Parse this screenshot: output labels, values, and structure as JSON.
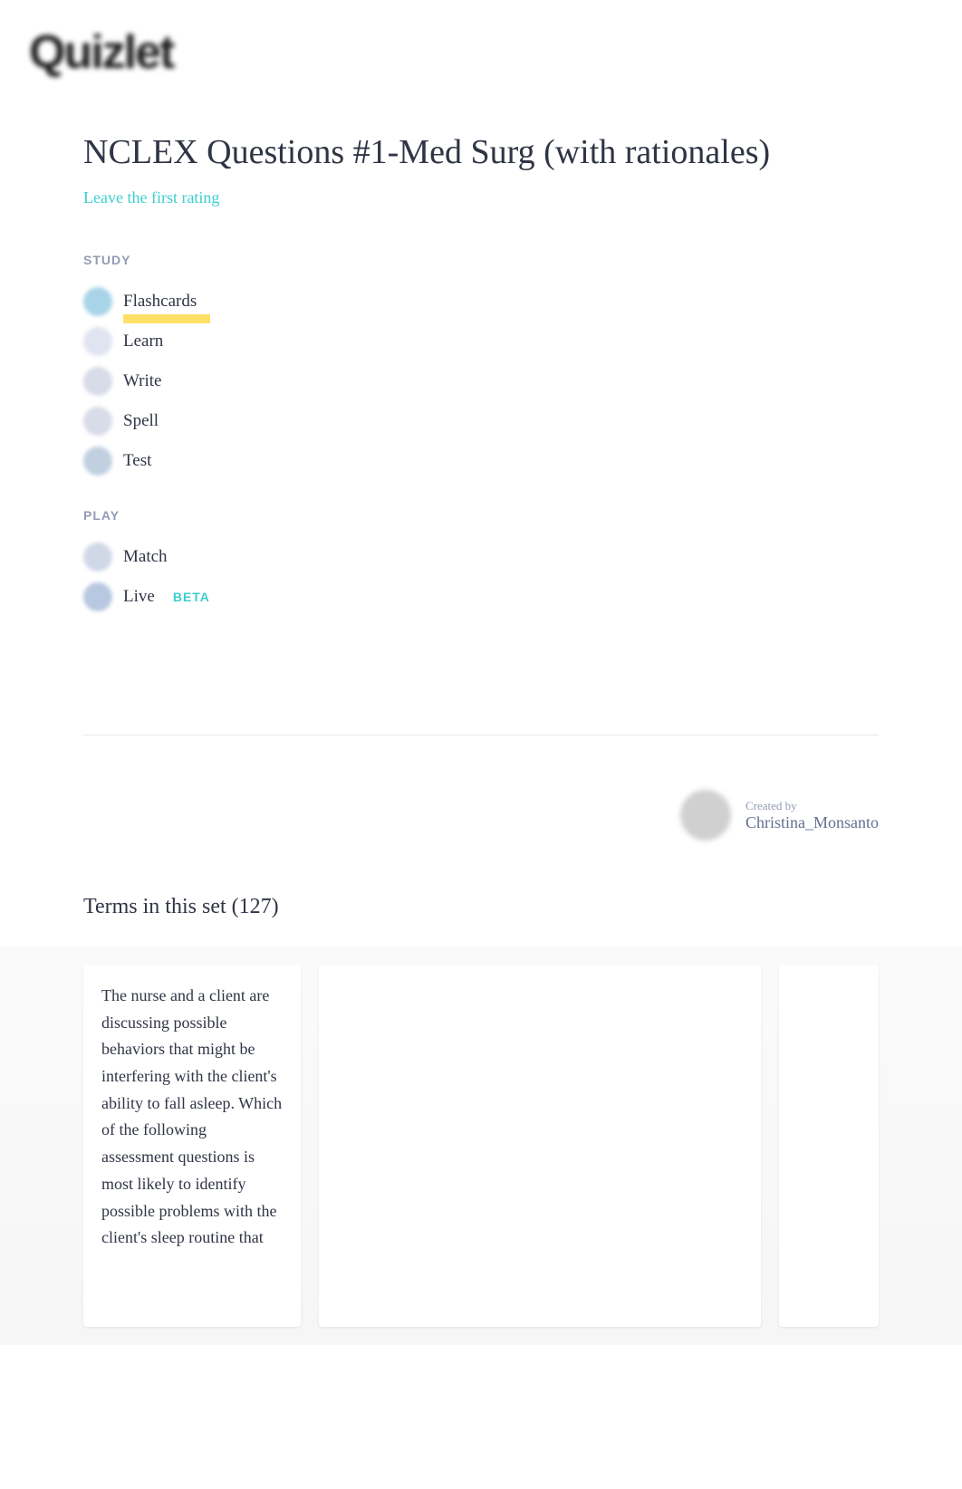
{
  "logo": "Quizlet",
  "title": "NCLEX Questions #1-Med Surg (with rationales)",
  "rating_link": "Leave the first rating",
  "sections": {
    "study": {
      "label": "STUDY",
      "modes": [
        {
          "label": "Flashcards",
          "icon": "flashcards",
          "highlighted": true
        },
        {
          "label": "Learn",
          "icon": "learn"
        },
        {
          "label": "Write",
          "icon": "write"
        },
        {
          "label": "Spell",
          "icon": "spell"
        },
        {
          "label": "Test",
          "icon": "test"
        }
      ]
    },
    "play": {
      "label": "PLAY",
      "modes": [
        {
          "label": "Match",
          "icon": "match"
        },
        {
          "label": "Live",
          "icon": "live",
          "badge": "BETA"
        }
      ]
    }
  },
  "creator": {
    "label": "Created by",
    "name": "Christina_Monsanto"
  },
  "terms": {
    "header_prefix": "Terms in this set (",
    "count": "127",
    "header_suffix": ")",
    "first_question": "The nurse and a client are discussing possible behaviors that might be interfering with the client's ability to fall asleep. Which of the following assessment questions is most likely to identify possible problems with the client's sleep routine that"
  }
}
